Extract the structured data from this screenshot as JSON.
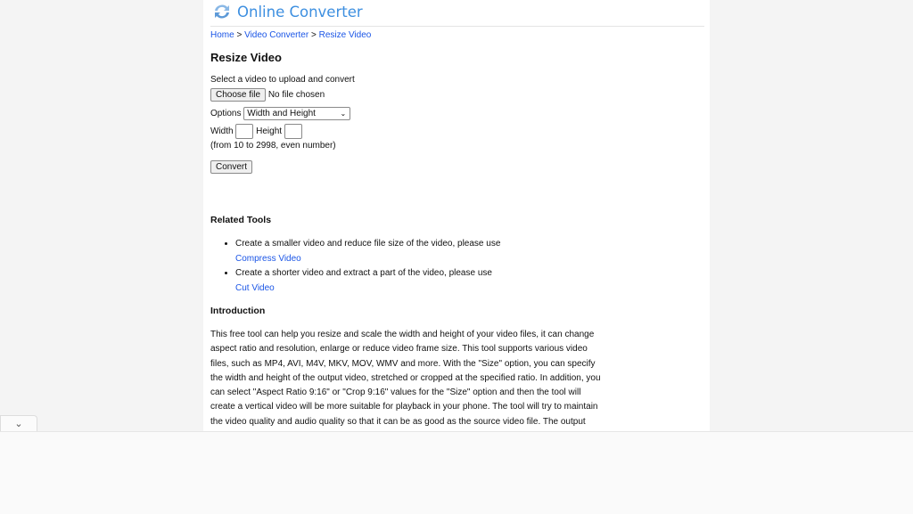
{
  "header": {
    "logo_text": "Online Converter"
  },
  "breadcrumb": {
    "home": "Home",
    "sep": " > ",
    "video_converter": "Video Converter",
    "current": "Resize Video"
  },
  "page_title": "Resize Video",
  "form": {
    "select_label": "Select a video to upload and convert",
    "choose_file": "Choose file",
    "no_file": "No file chosen",
    "options_label": "Options",
    "options_value": "Width and Height",
    "width_label": "Width",
    "height_label": "Height",
    "range_hint": "(from 10 to 2998, even number)",
    "convert": "Convert"
  },
  "related": {
    "title": "Related Tools",
    "items": [
      {
        "text": "Create a smaller video and reduce file size of the video, please use",
        "link": "Compress Video"
      },
      {
        "text": "Create a shorter video and extract a part of the video, please use",
        "link": "Cut Video"
      }
    ]
  },
  "intro": {
    "title": "Introduction",
    "text": "This free tool can help you resize and scale the width and height of your video files, it can change aspect ratio and resolution, enlarge or reduce video frame size. This tool supports various video files, such as MP4, AVI, M4V, MKV, MOV, WMV and more. With the \"Size\" option, you can specify the width and height of the output video, stretched or cropped at the specified ratio. In addition, you can select \"Aspect Ratio 9:16\" or \"Crop 9:16\" values for the \"Size\" option and then the tool will create a vertical video will be more suitable for playback in your phone. The tool will try to maintain the video quality and audio quality so that it can be as good as the source video file. The output"
  },
  "colors": {
    "link": "#1a55e6",
    "logo": "#3d8fe0"
  }
}
